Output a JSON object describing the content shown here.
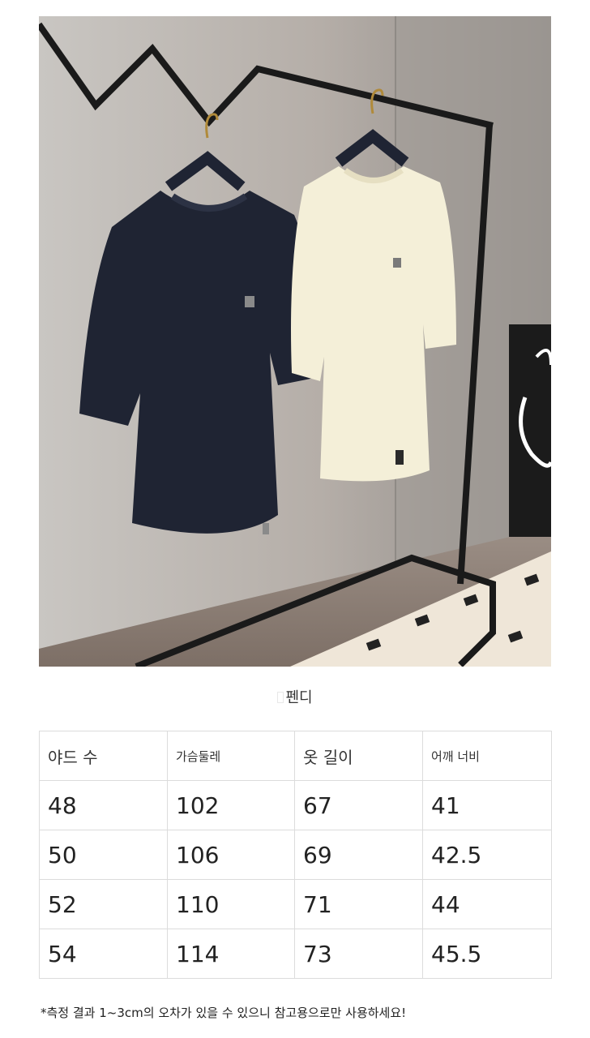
{
  "product_image": {
    "alt_icon": "product-photo",
    "accent": "#1f2433",
    "secondary": "#f4efd8"
  },
  "brand": {
    "name": "펜디"
  },
  "size_table": {
    "headers": [
      "야드 수",
      "가슴둘레",
      "옷 길이",
      "어깨 너비"
    ],
    "rows": [
      [
        "48",
        "102",
        "67",
        "41"
      ],
      [
        "50",
        "106",
        "69",
        "42.5"
      ],
      [
        "52",
        "110",
        "71",
        "44"
      ],
      [
        "54",
        "114",
        "73",
        "45.5"
      ]
    ]
  },
  "note": "*측정 결과 1~3cm의 오차가 있을 수 있으니 참고용으로만 사용하세요!"
}
